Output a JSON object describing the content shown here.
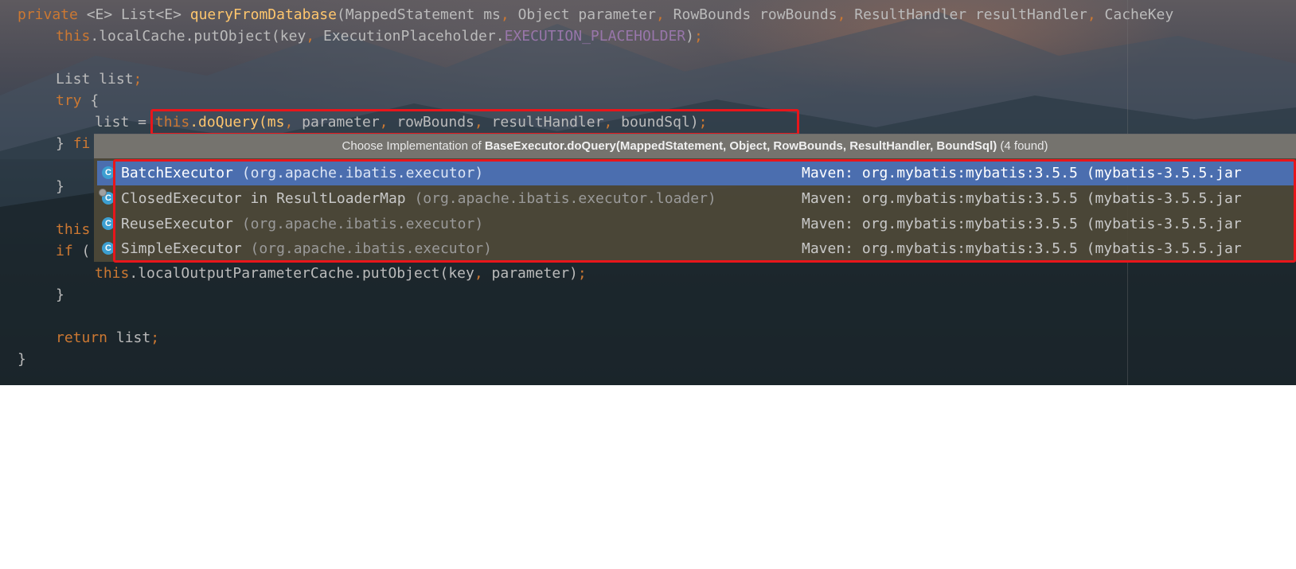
{
  "code": {
    "line1": {
      "kw": "private",
      "rest_a": " <E> List<E> ",
      "method": "queryFromDatabase",
      "params": "(MappedStatement ms",
      "c1": ",",
      "p2": " Object parameter",
      "c2": ",",
      "p3": " RowBounds rowBounds",
      "c3": ",",
      "p4": " ResultHandler resultHandler",
      "c4": ",",
      "p5": " CacheKey"
    },
    "line2": {
      "kw": "this",
      "a": ".localCache.putObject(key",
      "c": ",",
      "b": " ExecutionPlaceholder.",
      "const": "EXECUTION_PLACEHOLDER",
      "end": ")",
      "semi": ";"
    },
    "line3": {
      "a": "List list",
      "semi": ";"
    },
    "line4": {
      "kw": "try",
      "a": " {"
    },
    "line5": {
      "a": "list = ",
      "kw": "this",
      "b": ".doQuery(ms",
      "c1": ",",
      "d": " parameter",
      "c2": ",",
      "e": " rowBounds",
      "c3": ",",
      "f": " resultHandler",
      "c4": ",",
      "g": " boundSql)",
      "semi": ";"
    },
    "line6": {
      "a": "} ",
      "kw": "fi"
    },
    "line7": {
      "a": "}"
    },
    "line8": {
      "kw": "this"
    },
    "line9": {
      "kw": "if",
      "a": " ("
    },
    "line10": {
      "kw": "this",
      "a": ".localOutputParameterCache.putObject(key",
      "c": ",",
      "b": " parameter)",
      "semi": ";"
    },
    "line11": {
      "a": "}"
    },
    "line12": {
      "kw": "return",
      "a": " list",
      "semi": ";"
    },
    "line13": {
      "a": "}"
    }
  },
  "popup": {
    "header_prefix": "Choose Implementation of ",
    "header_method": "BaseExecutor.doQuery(MappedStatement, Object, RowBounds, ResultHandler, BoundSql)",
    "header_suffix": " (4 found)",
    "items": [
      {
        "icon": "class-icon",
        "icon_glyph": "C",
        "name": "BatchExecutor",
        "pkg": " (org.apache.ibatis.executor)",
        "location": "Maven: org.mybatis:mybatis:3.5.5 (mybatis-3.5.5.jar"
      },
      {
        "icon": "class-icon",
        "icon_glyph": "C",
        "name": "ClosedExecutor in ResultLoaderMap",
        "pkg": " (org.apache.ibatis.executor.loader)",
        "location": "Maven: org.mybatis:mybatis:3.5.5 (mybatis-3.5.5.jar"
      },
      {
        "icon": "class-icon",
        "icon_glyph": "C",
        "name": "ReuseExecutor",
        "pkg": " (org.apache.ibatis.executor)",
        "location": "Maven: org.mybatis:mybatis:3.5.5 (mybatis-3.5.5.jar"
      },
      {
        "icon": "class-icon",
        "icon_glyph": "C",
        "name": "SimpleExecutor",
        "pkg": " (org.apache.ibatis.executor)",
        "location": "Maven: org.mybatis:mybatis:3.5.5 (mybatis-3.5.5.jar"
      }
    ]
  },
  "colors": {
    "keyword": "#cc7832",
    "method": "#ffc66d",
    "constant": "#9876aa",
    "selection": "#4b6eaf",
    "highlight_box": "#e8161b"
  }
}
